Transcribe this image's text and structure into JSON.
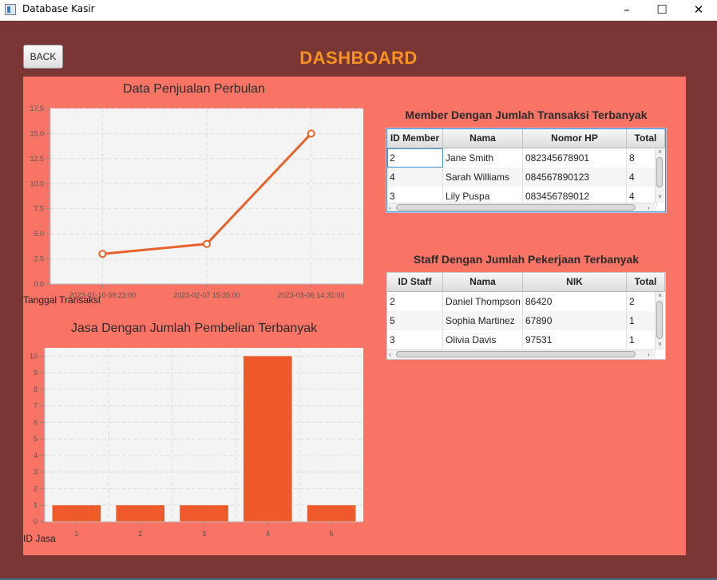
{
  "window": {
    "title": "Database Kasir",
    "minimize": "–",
    "maximize": "☐",
    "close": "✕"
  },
  "header": {
    "back_label": "BACK",
    "title": "DASHBOARD"
  },
  "colors": {
    "frame": "#7a3535",
    "panel": "#fa7466",
    "accent": "#f7931e",
    "line": "#e8632c",
    "bar": "#ee5a2a"
  },
  "line_chart": {
    "title": "Data Penjualan Perbulan",
    "xlabel": "Tanggal Transaksi",
    "y_ticks": [
      "0.0",
      "2.5",
      "5.0",
      "7.5",
      "10.0",
      "12.5",
      "15.0",
      "17.5"
    ]
  },
  "bar_chart": {
    "title": "Jasa Dengan Jumlah Pembelian Terbanyak",
    "xlabel": "ID Jasa",
    "y_ticks": [
      "0",
      "1",
      "2",
      "3",
      "4",
      "5",
      "6",
      "7",
      "8",
      "9",
      "10"
    ]
  },
  "chart_data": [
    {
      "type": "line",
      "title": "Data Penjualan Perbulan",
      "xlabel": "Tanggal Transaksi",
      "ylabel": "",
      "categories": [
        "2023-01-10 09:23:00",
        "2023-02-07 15:35:00",
        "2023-03-06 14:35:00"
      ],
      "values": [
        3,
        4,
        15
      ],
      "ylim": [
        0,
        17.5
      ],
      "grid": true,
      "legend": "none"
    },
    {
      "type": "bar",
      "title": "Jasa Dengan Jumlah Pembelian Terbanyak",
      "xlabel": "ID Jasa",
      "ylabel": "",
      "categories": [
        "1",
        "2",
        "3",
        "4",
        "5"
      ],
      "values": [
        1,
        1,
        1,
        10,
        1
      ],
      "ylim": [
        0,
        10.5
      ],
      "grid": true,
      "legend": "none"
    }
  ],
  "member_table": {
    "title": "Member Dengan Jumlah Transaksi Terbanyak",
    "columns": [
      "ID Member",
      "Nama",
      "Nomor HP",
      "Total"
    ],
    "rows": [
      [
        "2",
        "Jane Smith",
        "082345678901",
        "8"
      ],
      [
        "4",
        "Sarah Williams",
        "084567890123",
        "4"
      ],
      [
        "3",
        "Lily Puspa",
        "083456789012",
        "4"
      ]
    ]
  },
  "staff_table": {
    "title": "Staff Dengan Jumlah Pekerjaan Terbanyak",
    "columns": [
      "ID Staff",
      "Nama",
      "NIK",
      "Total"
    ],
    "rows": [
      [
        "2",
        "Daniel Thompson",
        "86420",
        "2"
      ],
      [
        "5",
        "Sophia Martinez",
        "67890",
        "1"
      ],
      [
        "3",
        "Olivia Davis",
        "97531",
        "1"
      ]
    ]
  }
}
